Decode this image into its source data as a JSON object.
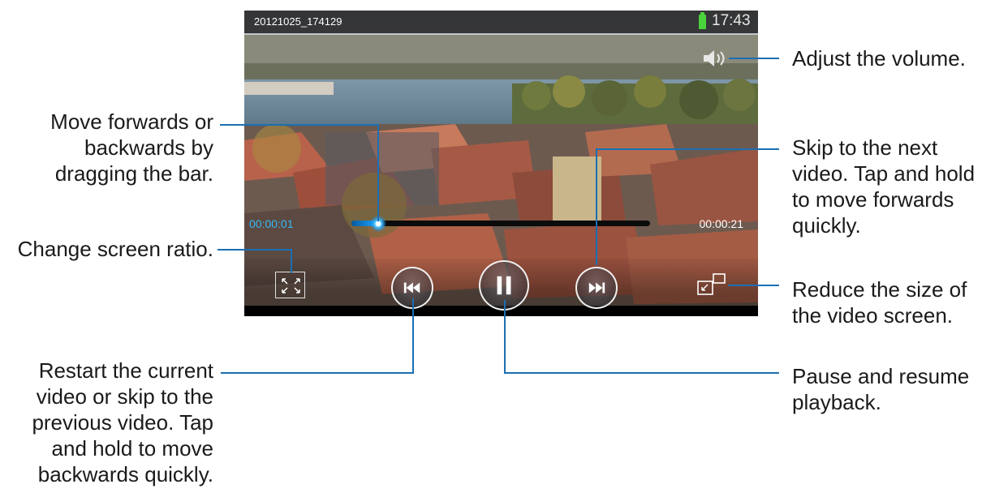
{
  "player": {
    "filename": "20121025_174129",
    "clock": "17:43",
    "time_elapsed": "00:00:01",
    "time_total": "00:00:21",
    "progress_fraction": 0.09
  },
  "colors": {
    "accent": "#35b8f5",
    "callout_line": "#1a6fb3",
    "battery": "#4ad23a"
  },
  "icons": {
    "volume": "speaker-icon",
    "ratio": "screen-ratio-icon",
    "previous": "rewind-icon",
    "pause": "pause-icon",
    "next": "fast-forward-icon",
    "popup": "pop-up-player-icon",
    "battery": "battery-icon"
  },
  "callouts": {
    "volume": "Adjust the volume.",
    "seek": [
      "Move forwards or",
      "backwards by",
      "dragging the bar."
    ],
    "next": [
      "Skip to the next",
      "video. Tap and hold",
      "to move forwards",
      "quickly."
    ],
    "ratio": "Change screen ratio.",
    "popup": [
      "Reduce the size of",
      "the video screen."
    ],
    "previous": [
      "Restart the current",
      "video or skip to the",
      "previous video. Tap",
      "and hold to move",
      "backwards quickly."
    ],
    "pause": [
      "Pause and resume",
      "playback."
    ]
  }
}
